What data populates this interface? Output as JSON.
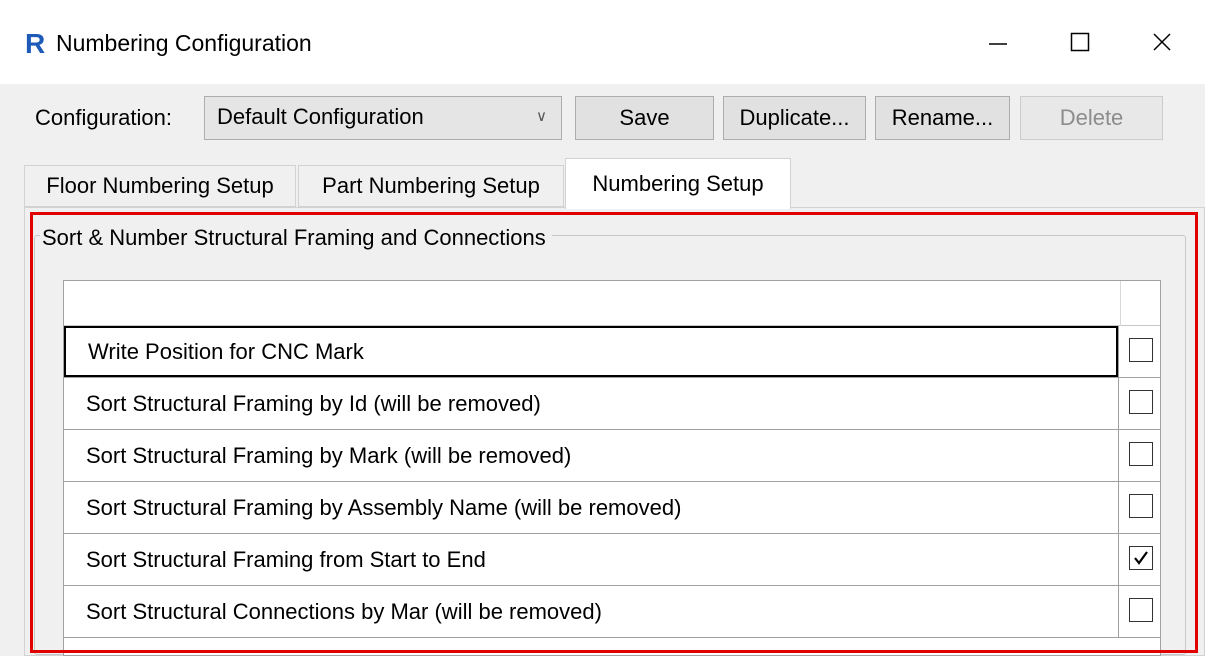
{
  "window": {
    "title": "Numbering Configuration",
    "app_icon": "revit-r-icon",
    "controls": [
      "minimize-icon",
      "maximize-icon",
      "close-icon"
    ]
  },
  "toolbar": {
    "config_label": "Configuration:",
    "config_value": "Default Configuration",
    "save_label": "Save",
    "duplicate_label": "Duplicate...",
    "rename_label": "Rename...",
    "delete_label": "Delete"
  },
  "tabs": [
    {
      "label": "Floor Numbering Setup",
      "selected": false
    },
    {
      "label": "Part Numbering Setup",
      "selected": false
    },
    {
      "label": "Numbering Setup",
      "selected": true
    }
  ],
  "group": {
    "title": "Sort & Number Structural Framing and Connections"
  },
  "rows": [
    {
      "label": "Write Position for CNC Mark",
      "checked": false
    },
    {
      "label": "Sort Structural Framing by Id (will be removed)",
      "checked": false
    },
    {
      "label": "Sort Structural Framing by Mark (will be removed)",
      "checked": false
    },
    {
      "label": "Sort Structural Framing by Assembly Name (will be removed)",
      "checked": false
    },
    {
      "label": "Sort Structural Framing from Start to End",
      "checked": true
    },
    {
      "label": "Sort Structural Connections by Mar (will be removed)",
      "checked": false
    }
  ],
  "colors": {
    "highlight": "#e00000",
    "revit_icon": "#1e5bb8"
  }
}
